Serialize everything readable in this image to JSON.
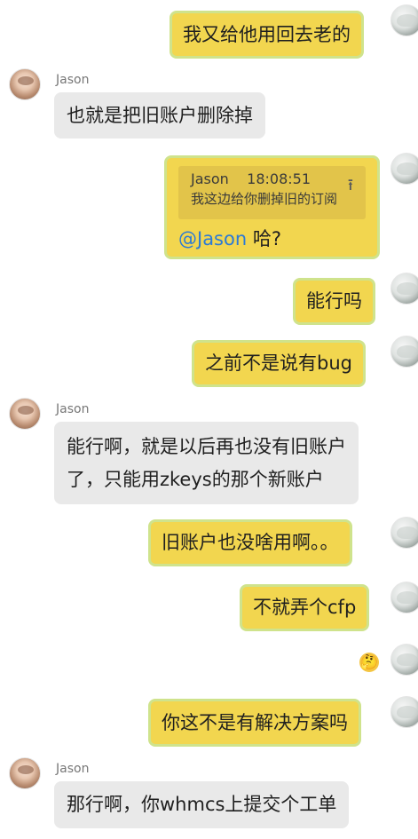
{
  "messages": [
    {
      "text": "我又给他用回去老的"
    },
    {
      "sender": "Jason",
      "text": "也就是把旧账户删除掉"
    },
    {
      "quote": {
        "name": "Jason",
        "time": "18:08:51",
        "text": "我这边给你删掉旧的订阅"
      },
      "mention": "@Jason",
      "text": " 哈?"
    },
    {
      "text": "能行吗"
    },
    {
      "text": "之前不是说有bug"
    },
    {
      "sender": "Jason",
      "line1": "能行啊，就是以后再也没有旧账户",
      "line2": "了，只能用zkeys的那个新账户"
    },
    {
      "text": "旧账户也没啥用啊。。"
    },
    {
      "text": "不就弄个cfp"
    },
    {
      "emoji": "🤔"
    },
    {
      "text": "你这不是有解决方案吗"
    },
    {
      "sender": "Jason",
      "text": "那行啊，你whmcs上提交个工单"
    }
  ]
}
